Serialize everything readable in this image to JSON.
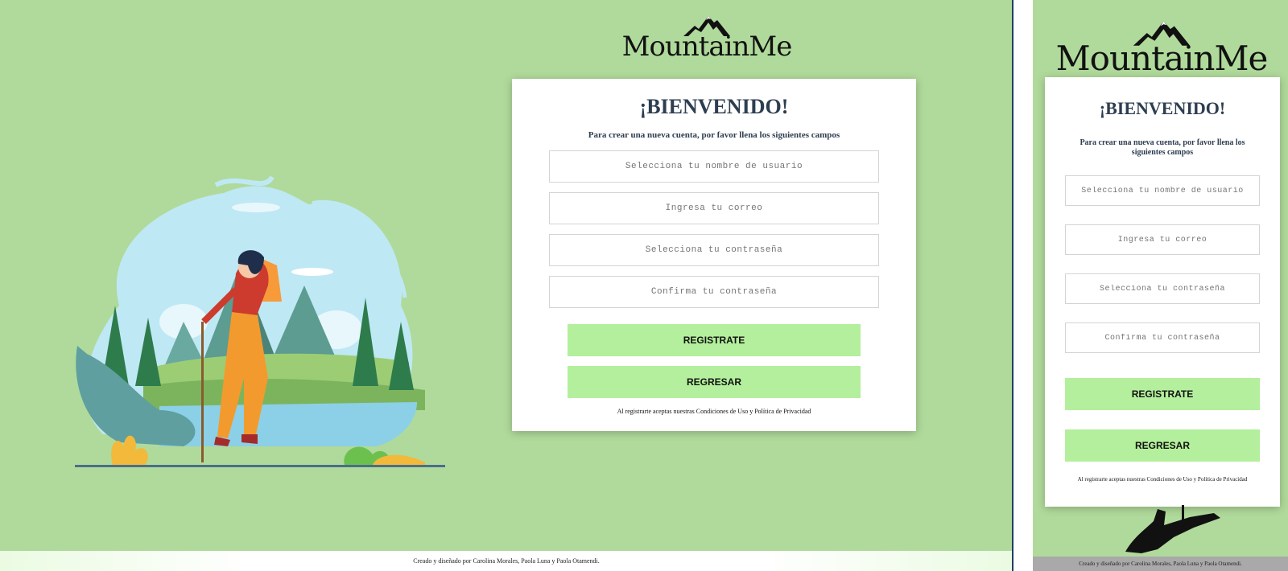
{
  "brand": {
    "name": "MountainMe",
    "logo_icon": "mountain-peaks-icon"
  },
  "signup": {
    "title": "¡BIENVENIDO!",
    "subtitle": "Para crear una nueva cuenta, por favor llena los siguientes campos",
    "fields": {
      "username_placeholder": "Selecciona tu nombre de usuario",
      "email_placeholder": "Ingresa tu correo",
      "password_placeholder": "Selecciona tu contraseña",
      "confirm_placeholder": "Confirma tu contraseña"
    },
    "register_label": "REGISTRATE",
    "back_label": "REGRESAR",
    "terms": "Al registrarte aceptas nuestras Condiciones de Uso y Política de Privacidad"
  },
  "footer": {
    "credits": "Creado y diseñado por Carolina Morales, Paola Luna y Paola Otamendi."
  },
  "colors": {
    "page_background": "#b0da9b",
    "button": "#b3ef9c",
    "title": "#2d3e50",
    "card": "#ffffff"
  },
  "illustrations": [
    "hiker-landscape-illustration",
    "climber-silhouette-illustration"
  ]
}
